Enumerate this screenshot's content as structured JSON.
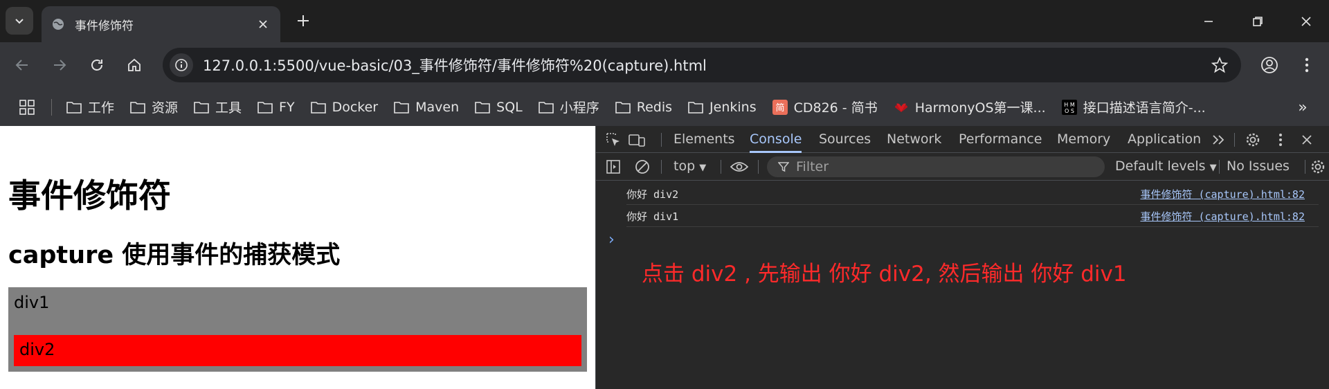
{
  "browser": {
    "tab_title": "事件修饰符",
    "url": "127.0.0.1:5500/vue-basic/03_事件修饰符/事件修饰符%20(capture).html"
  },
  "bookmarks": [
    {
      "label": "工作",
      "icon": "folder-icon"
    },
    {
      "label": "资源",
      "icon": "folder-icon"
    },
    {
      "label": "工具",
      "icon": "folder-icon"
    },
    {
      "label": "FY",
      "icon": "folder-icon"
    },
    {
      "label": "Docker",
      "icon": "folder-icon"
    },
    {
      "label": "Maven",
      "icon": "folder-icon"
    },
    {
      "label": "SQL",
      "icon": "folder-icon"
    },
    {
      "label": "小程序",
      "icon": "folder-icon"
    },
    {
      "label": "Redis",
      "icon": "folder-icon"
    },
    {
      "label": "Jenkins",
      "icon": "folder-icon"
    },
    {
      "label": "CD826 - 简书",
      "icon": "jianshu-icon"
    },
    {
      "label": "HarmonyOS第一课...",
      "icon": "huawei-icon"
    },
    {
      "label": "接口描述语言简介-...",
      "icon": "harmonyos-dev-icon"
    }
  ],
  "page": {
    "heading": "事件修饰符",
    "subheading": "capture 使用事件的捕获模式",
    "div1_label": "div1",
    "div2_label": "div2"
  },
  "devtools": {
    "tabs": [
      "Elements",
      "Console",
      "Sources",
      "Network",
      "Performance",
      "Memory",
      "Application"
    ],
    "active_tab": "Console",
    "context": "top",
    "filter_placeholder": "Filter",
    "levels": "Default levels",
    "issues": "No Issues",
    "logs": [
      {
        "message": "你好 div2",
        "source": "事件修饰符 (capture).html:82"
      },
      {
        "message": "你好 div1",
        "source": "事件修饰符 (capture).html:82"
      }
    ],
    "prompt": "›",
    "annotation": "点击 div2 , 先输出 你好 div2,  然后输出 你好 div1"
  },
  "colors": {
    "div1_bg": "#808080",
    "div2_bg": "#ff0000",
    "annotation": "#ff2a2a",
    "active_tab": "#a8c7fa"
  }
}
